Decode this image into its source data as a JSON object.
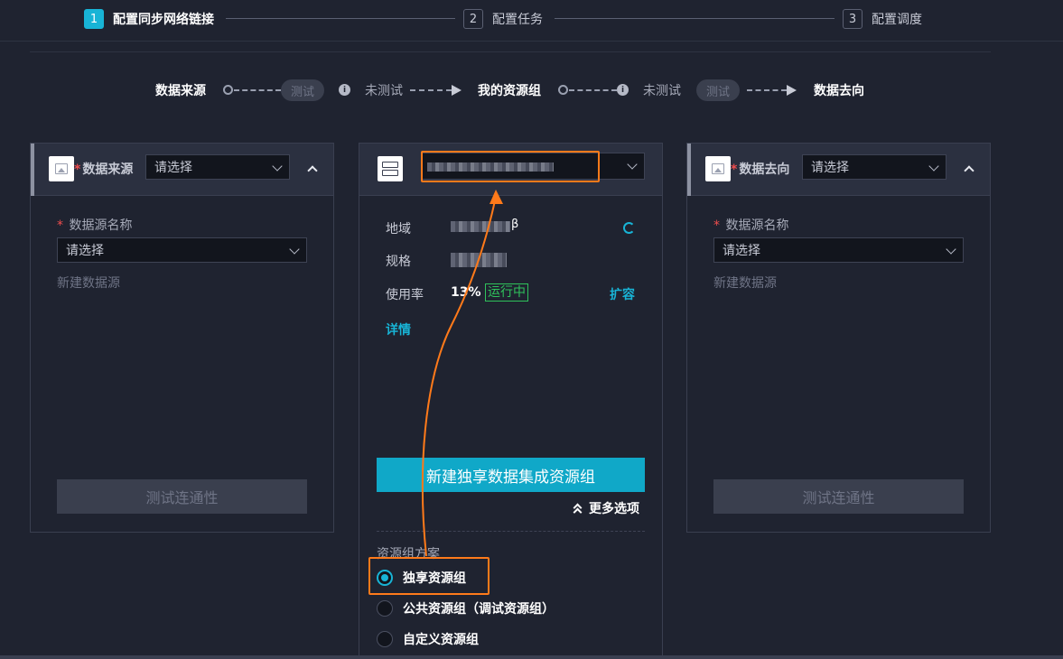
{
  "steps": [
    {
      "num": "1",
      "label": "配置同步网络链接"
    },
    {
      "num": "2",
      "label": "配置任务"
    },
    {
      "num": "3",
      "label": "配置调度"
    }
  ],
  "flow": {
    "source": "数据来源",
    "test1": "测试",
    "untested1": "未测试",
    "resource_group": "我的资源组",
    "untested2": "未测试",
    "test2": "测试",
    "target": "数据去向"
  },
  "source_panel": {
    "title": "数据来源",
    "select_placeholder": "请选择",
    "name_label": "数据源名称",
    "name_placeholder": "请选择",
    "new_link": "新建数据源",
    "test_button": "测试连通性",
    "icon": "image-icon"
  },
  "middle_panel": {
    "icon": "server-icon",
    "region_label": "地域",
    "region_suffix": "β",
    "spec_label": "规格",
    "usage_label": "使用率",
    "usage_value": "13%",
    "status": "运行中",
    "expand": "扩容",
    "details": "详情",
    "create_button": "新建独享数据集成资源组",
    "more_options": "更多选项",
    "scheme_label": "资源组方案",
    "options": [
      "独享资源组",
      "公共资源组（调试资源组）",
      "自定义资源组"
    ],
    "selected_index": 0
  },
  "target_panel": {
    "title": "数据去向",
    "select_placeholder": "请选择",
    "name_label": "数据源名称",
    "name_placeholder": "请选择",
    "new_link": "新建数据源",
    "test_button": "测试连通性",
    "icon": "image-icon"
  },
  "colors": {
    "accent": "#18b4d6",
    "highlight": "#ff7a1a",
    "running": "#2fc25b",
    "required": "#ef4d4d"
  }
}
